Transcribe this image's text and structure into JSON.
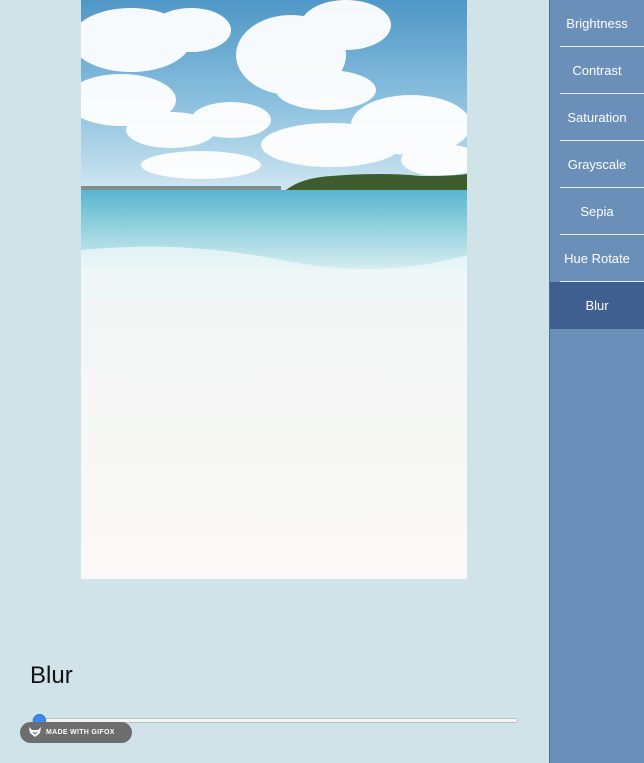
{
  "sidebar": {
    "items": [
      {
        "label": "Brightness"
      },
      {
        "label": "Contrast"
      },
      {
        "label": "Saturation"
      },
      {
        "label": "Grayscale"
      },
      {
        "label": "Sepia"
      },
      {
        "label": "Hue Rotate"
      },
      {
        "label": "Blur"
      }
    ],
    "active": "Blur"
  },
  "filter": {
    "title": "Blur",
    "slider_value": 0
  },
  "badge": {
    "label": "MADE WITH GIFOX"
  },
  "colors": {
    "background": "#cfe3e8",
    "sidebar": "#6a8fb8",
    "active_item": "#3e5f8f",
    "slider_thumb": "#3d86f3"
  },
  "icons": [
    "fox-logo-icon"
  ]
}
